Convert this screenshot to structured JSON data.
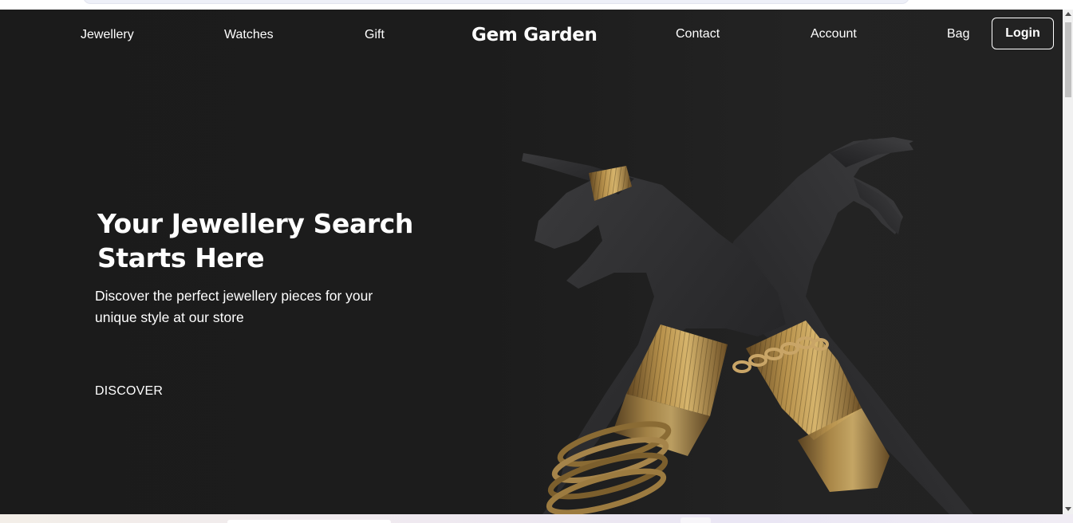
{
  "nav": {
    "links": [
      "Jewellery",
      "Watches",
      "Gift",
      "Contact",
      "Account",
      "Bag"
    ],
    "brand": "Gem Garden",
    "login_label": "Login"
  },
  "hero": {
    "title_line1": "Your Jewellery Search",
    "title_line2": "Starts Here",
    "subtitle_line1": "Discover the perfect jewellery pieces for your",
    "subtitle_line2": "unique style at our store",
    "cta": "DISCOVER"
  },
  "image": {
    "subject": "crossed dark hands wearing gold ring, bangles and chain bracelets"
  },
  "colors": {
    "background": "#1c1c1c",
    "text": "#ffffff",
    "gold": "#b08a45"
  }
}
